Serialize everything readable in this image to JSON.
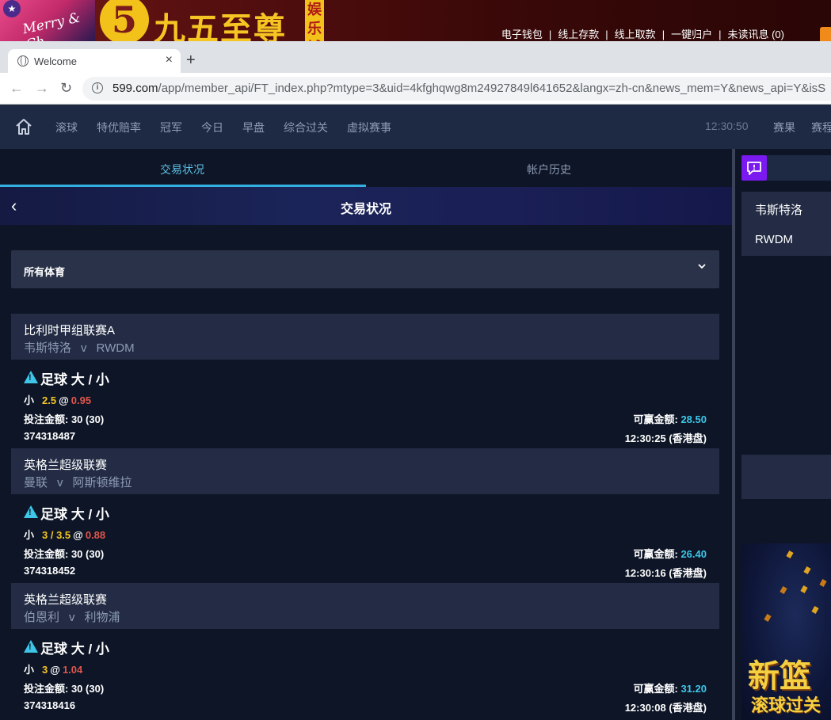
{
  "banner": {
    "greeting": "Merry & Ch",
    "logo_digit": "5",
    "site_name": "九五至尊",
    "badge": "娱乐城",
    "links": [
      "电子钱包",
      "线上存款",
      "线上取款",
      "一键归户",
      "未读讯息 (0)"
    ],
    "separator": "|"
  },
  "browser": {
    "tab_title": "Welcome",
    "tab_close": "×",
    "new_tab": "+",
    "url_host": "599.com",
    "url_path": "/app/member_api/FT_index.php?mtype=3&uid=4kfghqwg8m24927849l641652&langx=zh-cn&news_mem=Y&news_api=Y&isS"
  },
  "sitenav": {
    "items": [
      "滚球",
      "特优赔率",
      "冠军",
      "今日",
      "早盘",
      "综合过关",
      "虚拟赛事"
    ],
    "clock": "12:30:50",
    "right_items": [
      "赛果",
      "赛程"
    ]
  },
  "panel": {
    "tab_active": "交易状况",
    "tab_inactive": "帐户历史",
    "header_title": "交易状况",
    "filter_label": "所有体育"
  },
  "bets": [
    {
      "league": "比利时甲组联赛A",
      "home": "韦斯特洛",
      "vs": "v",
      "away": "RWDM",
      "type": "足球 大 / 小",
      "side": "小",
      "line": "2.5",
      "at": "@",
      "odds": "0.95",
      "stake_label": "投注金额: ",
      "stake": "30 (30)",
      "win_label": "可赢金额: ",
      "win": "28.50",
      "id": "374318487",
      "time": "12:30:25 (香港盘)"
    },
    {
      "league": "英格兰超级联赛",
      "home": "曼联",
      "vs": "v",
      "away": "阿斯顿维拉",
      "type": "足球 大 / 小",
      "side": "小",
      "line": "3 / 3.5",
      "at": "@",
      "odds": "0.88",
      "stake_label": "投注金额: ",
      "stake": "30 (30)",
      "win_label": "可赢金额: ",
      "win": "26.40",
      "id": "374318452",
      "time": "12:30:16 (香港盘)"
    },
    {
      "league": "英格兰超级联赛",
      "home": "伯恩利",
      "vs": "v",
      "away": "利物浦",
      "type": "足球 大 / 小",
      "side": "小",
      "line": "3",
      "at": "@",
      "odds": "1.04",
      "stake_label": "投注金额: ",
      "stake": "30 (30)",
      "win_label": "可赢金额: ",
      "win": "31.20",
      "id": "374318416",
      "time": "12:30:08 (香港盘)"
    }
  ],
  "right_panel": {
    "team1": "韦斯特洛",
    "team2": "RWDM",
    "promo_big": "新篮",
    "promo_small": "滚球过关"
  },
  "icons": {
    "home": "home-icon",
    "back": "chevron-left-icon",
    "dropdown": "chevron-down-icon",
    "warning": "warning-icon",
    "message": "message-icon",
    "globe": "globe-icon",
    "lock": "info-icon"
  },
  "colors": {
    "accent": "#34b0e0",
    "odds": "#e0564b",
    "line": "#f5c623",
    "win": "#3ec6e8"
  }
}
